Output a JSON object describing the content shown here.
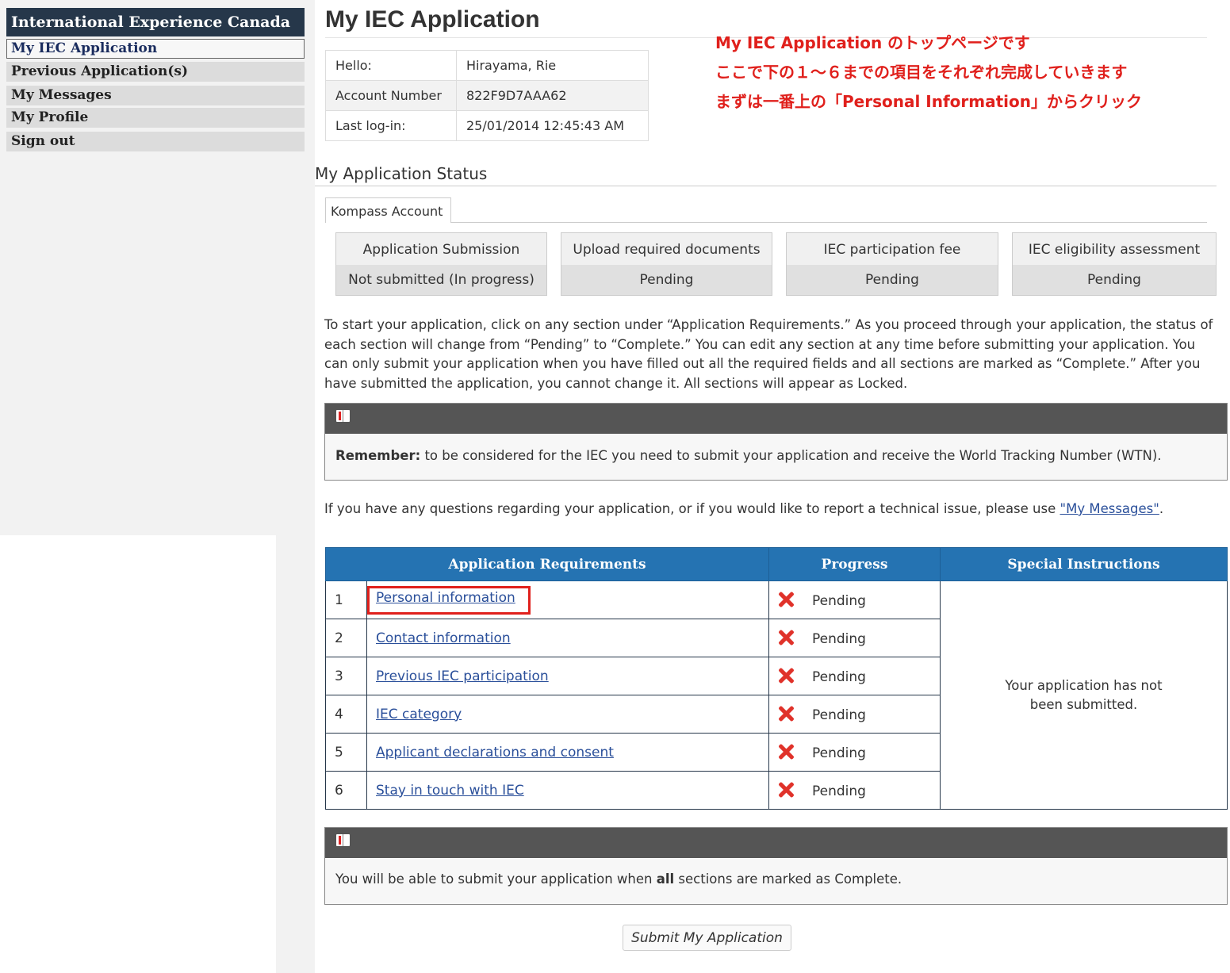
{
  "sidebar": {
    "header": "International Experience Canada",
    "items": [
      {
        "label": "My IEC Application"
      },
      {
        "label": "Previous Application(s)"
      },
      {
        "label": "My Messages"
      },
      {
        "label": "My Profile"
      },
      {
        "label": "Sign out"
      }
    ]
  },
  "page": {
    "title": "My IEC Application"
  },
  "account": {
    "rows": [
      {
        "label": "Hello:",
        "value": "Hirayama, Rie"
      },
      {
        "label": "Account Number",
        "value": "822F9D7AAA62"
      },
      {
        "label": "Last log-in:",
        "value": "25/01/2014 12:45:43 AM"
      }
    ]
  },
  "annotation": {
    "lines": [
      "My IEC Application のトップページです",
      "ここで下の１～６までの項目をそれぞれ完成していきます",
      "まずは一番上の「Personal Information」からクリック"
    ],
    "color": "#e0201c"
  },
  "status": {
    "heading": "My Application Status",
    "tab": "Kompass Account",
    "steps": [
      {
        "label": "Application Submission",
        "status": "Not submitted (In progress)"
      },
      {
        "label": "Upload required documents",
        "status": "Pending"
      },
      {
        "label": "IEC participation fee",
        "status": "Pending"
      },
      {
        "label": "IEC eligibility assessment",
        "status": "Pending"
      }
    ]
  },
  "intro": {
    "text": "To start your application, click on any section under “Application Requirements.” As you proceed through your application, the status of each section will change from “Pending” to “Complete.” You can edit any section at any time before submitting your application. You can only submit your application when you have filled out all the required fields and all sections are marked as “Complete.” After you have submitted the application, you cannot change it. All sections will appear as Locked."
  },
  "remember": {
    "bold": "Remember:",
    "text": " to be considered for the IEC you need to submit your application and receive the World Tracking Number (WTN)."
  },
  "contact": {
    "text": "If you have any questions regarding your application, or if you would like to report a technical issue, please use ",
    "link": "\"My Messages\"",
    "end": "."
  },
  "requirements": {
    "headers": [
      "Application Requirements",
      "Progress",
      "Special Instructions"
    ],
    "rows": [
      {
        "num": "1",
        "label": "Personal information",
        "progress": "Pending"
      },
      {
        "num": "2",
        "label": "Contact information",
        "progress": "Pending"
      },
      {
        "num": "3",
        "label": "Previous IEC participation",
        "progress": "Pending"
      },
      {
        "num": "4",
        "label": "IEC category",
        "progress": "Pending"
      },
      {
        "num": "5",
        "label": "Applicant declarations and consent",
        "progress": "Pending"
      },
      {
        "num": "6",
        "label": "Stay in touch with IEC",
        "progress": "Pending"
      }
    ],
    "instructions_line1": "Your application has not",
    "instructions_line2": "been submitted."
  },
  "final_notice": {
    "pre": "You will be able to submit your application when ",
    "bold": "all",
    "post": " sections are marked as Complete."
  },
  "submit": {
    "label": "Submit My Application"
  },
  "colors": {
    "header_blue": "#2573b2",
    "sidebar_navy": "#26374a",
    "status_red": "#e0322a"
  }
}
